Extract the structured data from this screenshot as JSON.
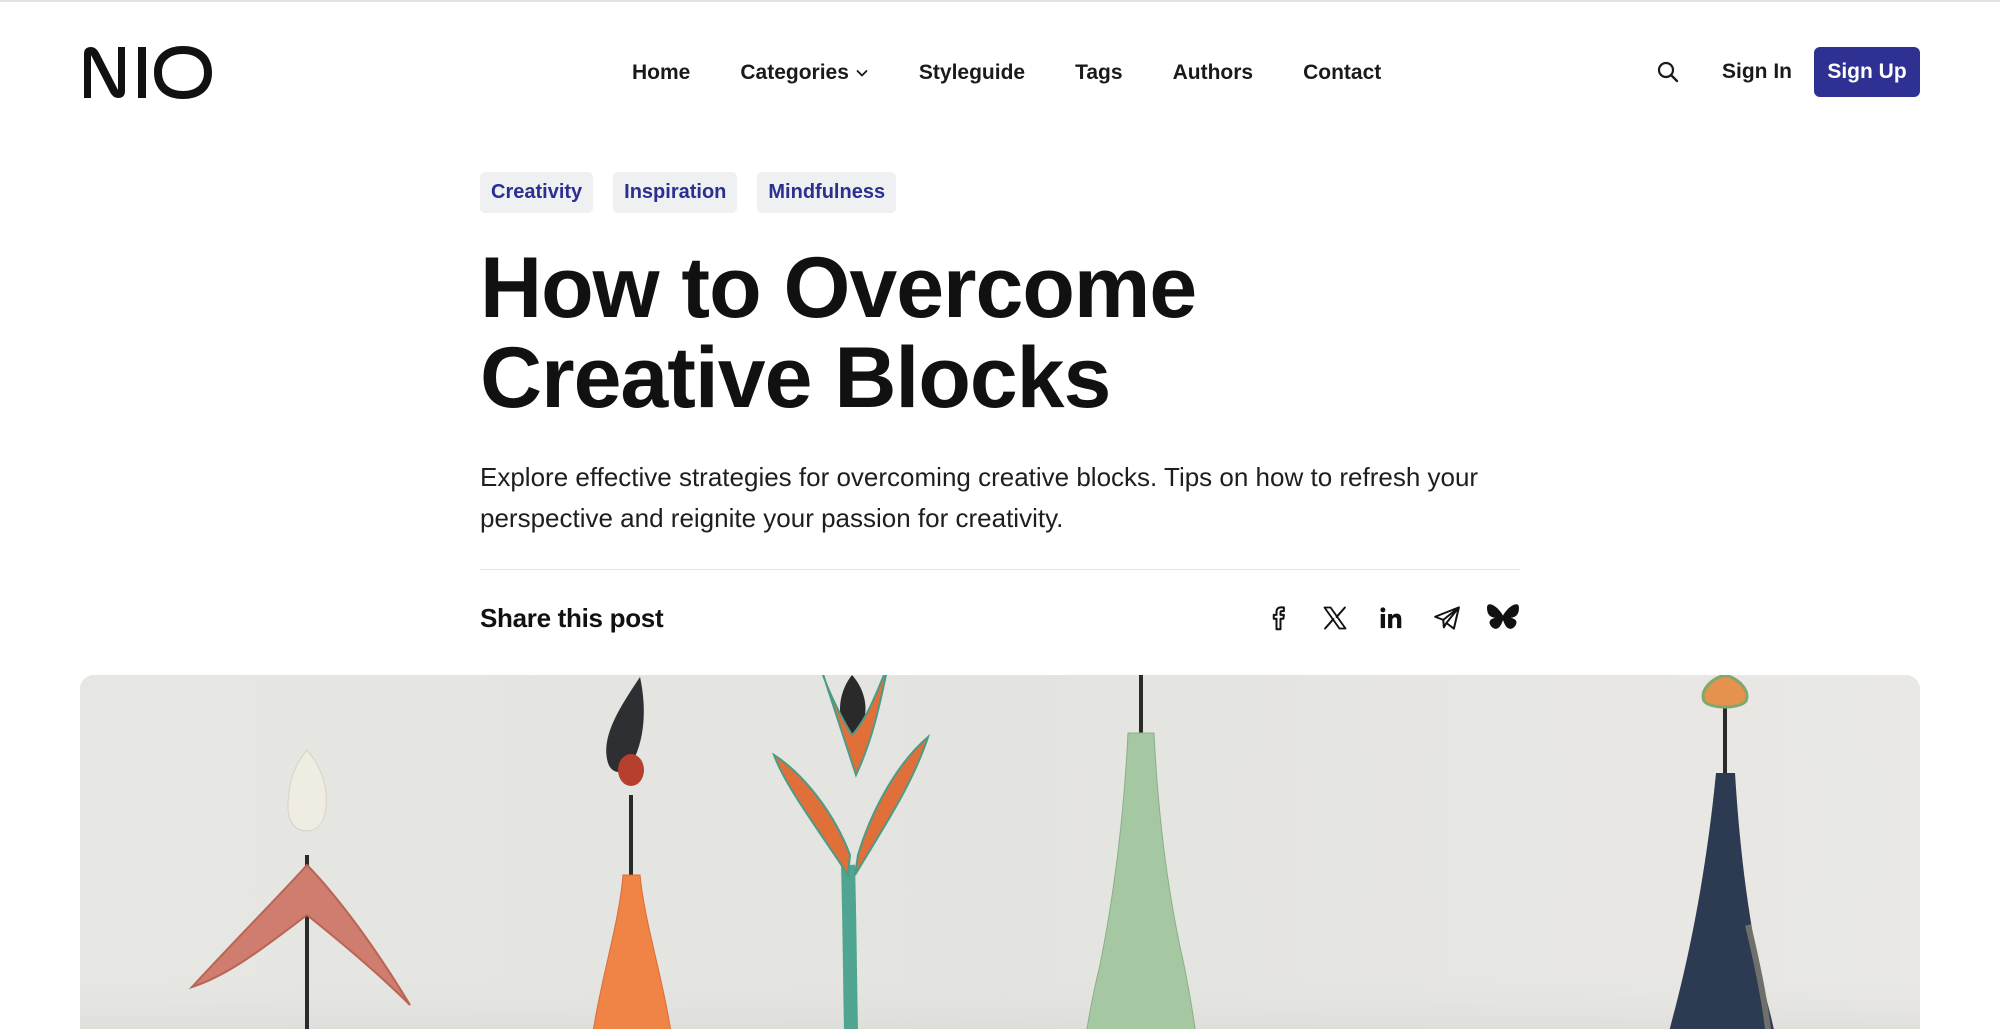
{
  "site": {
    "logo_text": "NIO",
    "brand_color": "#2e3192"
  },
  "nav": {
    "items": [
      {
        "label": "Home"
      },
      {
        "label": "Categories",
        "has_dropdown": true
      },
      {
        "label": "Styleguide"
      },
      {
        "label": "Tags"
      },
      {
        "label": "Authors"
      },
      {
        "label": "Contact"
      }
    ]
  },
  "header_actions": {
    "search_icon": "search-icon",
    "sign_in_label": "Sign In",
    "sign_up_label": "Sign Up"
  },
  "post": {
    "tags": [
      "Creativity",
      "Inspiration",
      "Mindfulness"
    ],
    "title": "How to Overcome Creative Blocks",
    "excerpt": "Explore effective strategies for overcoming creative blocks. Tips on how to refresh your perspective and reignite your passion for creativity.",
    "share_label": "Share this post",
    "share_icons": [
      "facebook-icon",
      "x-icon",
      "linkedin-icon",
      "telegram-icon",
      "bluesky-icon"
    ]
  }
}
